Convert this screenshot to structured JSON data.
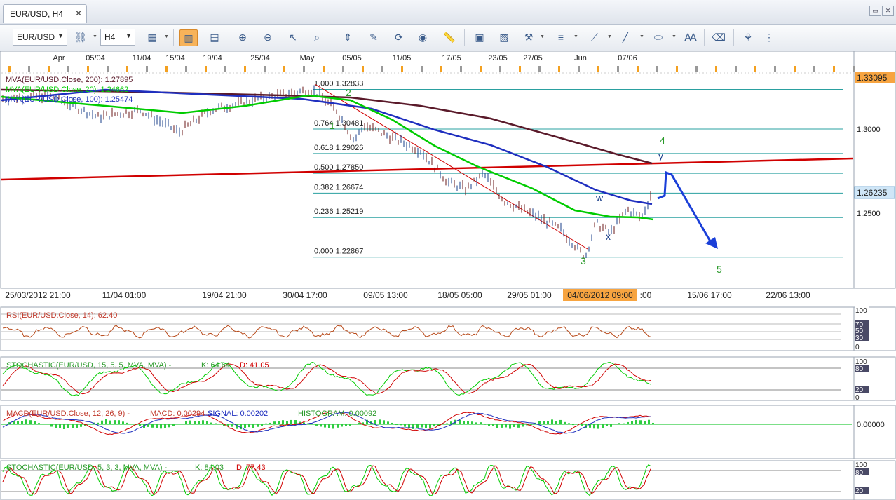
{
  "window": {
    "tab_title": "EUR/USD, H4",
    "close_glyph": "✕"
  },
  "toolbar": {
    "symbol": "EUR/USD",
    "timeframe": "H4",
    "icons": [
      "chart-type-icon",
      "zoom-icon",
      "candles-icon",
      "bars-icon",
      "zoom-in-icon",
      "zoom-out-icon",
      "cursor-icon",
      "magnifier-icon",
      "fit-icon",
      "edit-icon",
      "refresh-icon",
      "globe-icon",
      "ruler-icon",
      "image-icon",
      "template-icon",
      "tools-icon",
      "lines-icon",
      "draw-icon",
      "pen-icon",
      "ellipse-icon",
      "text-icon",
      "eraser-icon",
      "tree-icon",
      "menu-icon"
    ]
  },
  "chart": {
    "top_dates": [
      "Apr",
      "05/04",
      "11/04",
      "15/04",
      "19/04",
      "25/04",
      "May",
      "05/05",
      "11/05",
      "17/05",
      "23/05",
      "27/05",
      "Jun",
      "07/06"
    ],
    "bottom_dates": [
      "25/03/2012 21:00",
      "11/04 01:00",
      "19/04 21:00",
      "30/04 17:00",
      "09/05 13:00",
      "18/05 05:00",
      "29/05 01:00",
      "04/06/2012 09:00",
      ":00",
      "15/06 17:00",
      "22/06 13:00"
    ],
    "price_labels": [
      "1.3000",
      "1.2500"
    ],
    "price_current_top": "1.33095",
    "price_current": "1.26235",
    "mva": [
      {
        "label": "MVA(EUR/USD.Close, 200): 1.27895",
        "color": "#5a1a2a"
      },
      {
        "label": "MVA(EUR/USD.Close, 20): 1.24662",
        "color": "#00cc00"
      },
      {
        "label": "MVA(EUR/USD.Close, 100): 1.25474",
        "color": "#1f2fbf"
      }
    ],
    "fib": [
      {
        "label": "1.000 1.32833",
        "price": 1.32833
      },
      {
        "label": "0.764 1.30481",
        "price": 1.30481
      },
      {
        "label": "0.618 1.29026",
        "price": 1.29026
      },
      {
        "label": "0.500 1.27850",
        "price": 1.2785
      },
      {
        "label": "0.382 1.26674",
        "price": 1.26674
      },
      {
        "label": "0.236 1.25219",
        "price": 1.25219
      },
      {
        "label": "0.000 1.22867",
        "price": 1.22867
      }
    ],
    "waves": [
      "1",
      "2",
      "3",
      "4",
      "5",
      "w",
      "x",
      "y"
    ]
  },
  "indicators": {
    "rsi": {
      "label": "RSI(EUR/USD.Close, 14): 62.40",
      "levels": [
        "100",
        "70",
        "50",
        "30",
        "0"
      ]
    },
    "stoch1": {
      "main": "STOCHASTIC(EUR/USD, 15, 5, 5, MVA, MVA) -",
      "k": "K: 64.64",
      "d": "D: 41.05",
      "levels": [
        "100",
        "80",
        "20",
        "0"
      ]
    },
    "macd": {
      "main": "MACD(EUR/USD.Close, 12, 26, 9) -",
      "macd": "MACD: 0.00294",
      "signal": "SIGNAL: 0.00202",
      "hist": "HISTOGRAM: 0.00092",
      "level": "0.00000"
    },
    "stoch2": {
      "main": "STOCHASTIC(EUR/USD, 5, 3, 3, MVA, MVA) -",
      "k": "K: 84.03",
      "d": "D: 77.43",
      "levels": [
        "100",
        "80",
        "20"
      ]
    }
  },
  "colors": {
    "mva200": "#5a1a2a",
    "mva20": "#00cc00",
    "mva100": "#1f2fbf",
    "trend": "#d00000",
    "fib": "#2aa0a0",
    "arrow": "#1a3fd8",
    "wave": "#2a9a2a",
    "highlight": "#f7a440"
  }
}
